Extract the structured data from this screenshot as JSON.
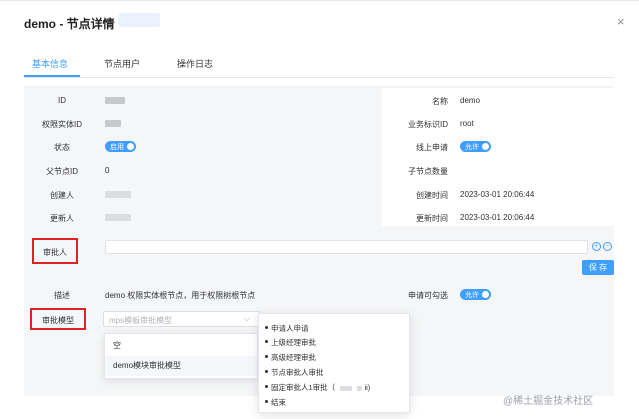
{
  "dialog": {
    "title": "demo - 节点详情",
    "close_glyph": "×",
    "close_icon": "close-icon"
  },
  "tabs": [
    {
      "label": "基本信息",
      "active": true
    },
    {
      "label": "节点用户",
      "active": false
    },
    {
      "label": "操作日志",
      "active": false
    }
  ],
  "fields": {
    "id_label": "ID",
    "name_label": "名称",
    "name_value": "demo",
    "entity_id_label": "权限实体ID",
    "biz_id_label": "业务标识ID",
    "biz_id_value": "root",
    "status_label": "状态",
    "status_switch": "启用",
    "online_apply_label": "线上申请",
    "online_apply_switch": "允许",
    "parent_id_label": "父节点ID",
    "parent_id_value": "0",
    "child_count_label": "子节点数量",
    "creator_label": "创建人",
    "created_time_label": "创建时间",
    "created_time_value": "2023-03-01 20:06:44",
    "updater_label": "更新人",
    "updated_time_label": "更新时间",
    "updated_time_value": "2023-03-01 20:06:44",
    "approver_label": "审批人",
    "add_glyph": "+",
    "remove_glyph": "−",
    "save_label": "保 存",
    "desc_label": "描述",
    "desc_value": "demo 权限实体根节点，用于权限树根节点",
    "apply_selectable_label": "申请可勾选",
    "apply_selectable_switch": "允许",
    "approval_model_label": "审批模型",
    "approval_model_placeholder": "mps模板审批模型",
    "chevron_glyph": "⌵"
  },
  "dropdown_options": [
    "空",
    "demo模块审批模型"
  ],
  "popover_items": [
    "申请人申请",
    "上级经理审批",
    "高级经理审批",
    "节点审批人审批",
    "固定审批人1审批（",
    "结束"
  ],
  "popover_tail": "ii)",
  "watermark": "@稀土掘金技术社区",
  "colors": {
    "accent": "#409eff",
    "highlight_border": "#e02222",
    "panel_bg": "#f5f6f7"
  }
}
